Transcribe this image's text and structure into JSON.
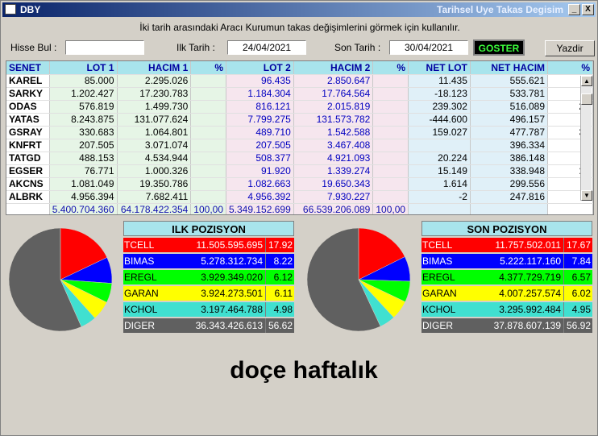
{
  "window": {
    "title_left": "DBY",
    "title_right": "Tarihsel Uye Takas Degisim",
    "min_label": "_",
    "close_label": "X"
  },
  "hint": "İki tarih arasındaki  Aracı Kurumun takas değişimlerini görmek için kullanılır.",
  "toolbar": {
    "hisse_label": "Hisse Bul :",
    "hisse_value": "",
    "ilk_label": "Ilk Tarih :",
    "ilk_value": "24/04/2021",
    "son_label": "Son Tarih :",
    "son_value": "30/04/2021",
    "goster_label": "GOSTER",
    "yazdir_label": "Yazdir"
  },
  "grid": {
    "headers": [
      "SENET",
      "LOT 1",
      "HACIM 1",
      "%",
      "LOT 2",
      "HACIM 2",
      "%",
      "NET LOT",
      "NET HACIM",
      "%"
    ],
    "rows": [
      [
        "KAREL",
        "85.000",
        "2.295.026",
        "",
        "96.435",
        "2.850.647",
        "",
        "11.435",
        "555.621",
        "11"
      ],
      [
        "SARKY",
        "1.202.427",
        "17.230.783",
        "",
        "1.184.304",
        "17.764.564",
        "",
        "-18.123",
        "533.781",
        "-1"
      ],
      [
        "ODAS",
        "576.819",
        "1.499.730",
        "",
        "816.121",
        "2.015.819",
        "",
        "239.302",
        "516.089",
        "29"
      ],
      [
        "YATAS",
        "8.243.875",
        "131.077.624",
        "",
        "7.799.275",
        "131.573.782",
        "",
        "-444.600",
        "496.157",
        "-5"
      ],
      [
        "GSRAY",
        "330.683",
        "1.064.801",
        "",
        "489.710",
        "1.542.588",
        "",
        "159.027",
        "477.787",
        "32"
      ],
      [
        "KNFRT",
        "207.505",
        "3.071.074",
        "",
        "207.505",
        "3.467.408",
        "",
        "",
        "396.334",
        ""
      ],
      [
        "TATGD",
        "488.153",
        "4.534.944",
        "",
        "508.377",
        "4.921.093",
        "",
        "20.224",
        "386.148",
        "3"
      ],
      [
        "EGSER",
        "76.771",
        "1.000.326",
        "",
        "91.920",
        "1.339.274",
        "",
        "15.149",
        "338.948",
        "16"
      ],
      [
        "AKCNS",
        "1.081.049",
        "19.350.786",
        "",
        "1.082.663",
        "19.650.343",
        "",
        "1.614",
        "299.556",
        "0"
      ],
      [
        "ALBRK",
        "4.956.394",
        "7.682.411",
        "",
        "4.956.392",
        "7.930.227",
        "",
        "-2",
        "247.816",
        "-0"
      ]
    ],
    "total": [
      "",
      "5.400.704.360",
      "64.178.422.354",
      "100,00",
      "5.349.152.699",
      "66.539.206.089",
      "100,00",
      "",
      "",
      ""
    ]
  },
  "ilk_pozisyon": {
    "title": "ILK POZISYON",
    "items": [
      {
        "name": "TCELL",
        "value": "11.505.595.695",
        "pct": "17.92",
        "color": "#ff0000",
        "text": "#ffffff",
        "pctcolor": "#ff0000"
      },
      {
        "name": "BIMAS",
        "value": "5.278.312.734",
        "pct": "8.22",
        "color": "#0000ff",
        "text": "#ffffff",
        "pctcolor": "#0000ff"
      },
      {
        "name": "EREGL",
        "value": "3.929.349.020",
        "pct": "6.12",
        "color": "#00ff00",
        "text": "#000000",
        "pctcolor": "#00ff00"
      },
      {
        "name": "GARAN",
        "value": "3.924.273.501",
        "pct": "6.11",
        "color": "#ffff00",
        "text": "#000000",
        "pctcolor": "#ffff00"
      },
      {
        "name": "KCHOL",
        "value": "3.197.464.788",
        "pct": "4.98",
        "color": "#40e0d0",
        "text": "#000000",
        "pctcolor": "#40e0d0"
      },
      {
        "name": "DIGER",
        "value": "36.343.426.613",
        "pct": "56.62",
        "color": "#606060",
        "text": "#ffffff",
        "pctcolor": "#606060"
      }
    ]
  },
  "son_pozisyon": {
    "title": "SON POZISYON",
    "items": [
      {
        "name": "TCELL",
        "value": "11.757.502.011",
        "pct": "17.67",
        "color": "#ff0000",
        "text": "#ffffff",
        "pctcolor": "#ff0000"
      },
      {
        "name": "BIMAS",
        "value": "5.222.117.160",
        "pct": "7.84",
        "color": "#0000ff",
        "text": "#ffffff",
        "pctcolor": "#0000ff"
      },
      {
        "name": "EREGL",
        "value": "4.377.729.719",
        "pct": "6.57",
        "color": "#00ff00",
        "text": "#000000",
        "pctcolor": "#00ff00"
      },
      {
        "name": "GARAN",
        "value": "4.007.257.574",
        "pct": "6.02",
        "color": "#ffff00",
        "text": "#000000",
        "pctcolor": "#ffff00"
      },
      {
        "name": "KCHOL",
        "value": "3.295.992.484",
        "pct": "4.95",
        "color": "#40e0d0",
        "text": "#000000",
        "pctcolor": "#40e0d0"
      },
      {
        "name": "DIGER",
        "value": "37.878.607.139",
        "pct": "56.92",
        "color": "#606060",
        "text": "#ffffff",
        "pctcolor": "#606060"
      }
    ]
  },
  "watermark": "doçe haftalık"
}
